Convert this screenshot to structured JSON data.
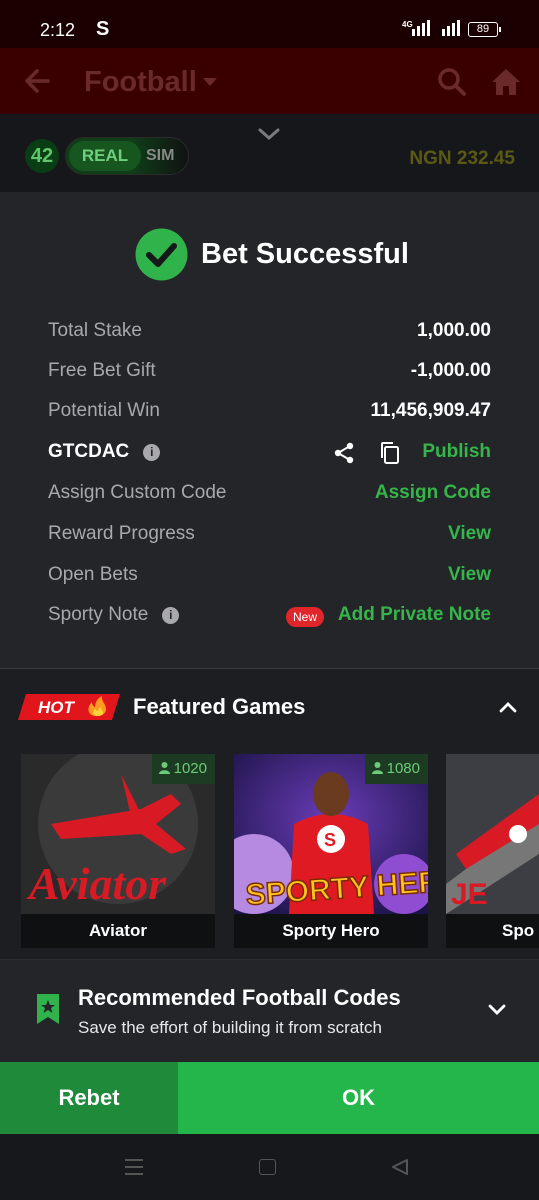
{
  "status_bar": {
    "time": "2:12",
    "app_icon": "S",
    "network": "4G",
    "battery": "89"
  },
  "app_bar": {
    "title": "Football"
  },
  "sub_bar": {
    "count": "42",
    "toggle_on": "REAL",
    "toggle_off": "SIM",
    "balance": "NGN 232.45"
  },
  "result": {
    "title": "Bet Successful",
    "rows": [
      {
        "label": "Total Stake",
        "value": "1,000.00"
      },
      {
        "label": "Free Bet Gift",
        "value": "-1,000.00"
      },
      {
        "label": "Potential Win",
        "value": "11,456,909.47"
      }
    ],
    "code": {
      "label": "GTCDAC",
      "publish": "Publish"
    },
    "assign": {
      "label": "Assign Custom Code",
      "action": "Assign Code"
    },
    "reward": {
      "label": "Reward Progress",
      "action": "View"
    },
    "open_bets": {
      "label": "Open Bets",
      "action": "View"
    },
    "note": {
      "label": "Sporty Note",
      "badge": "New",
      "action": "Add Private Note"
    }
  },
  "featured": {
    "hot_label": "HOT",
    "title": "Featured Games",
    "games": [
      {
        "name": "Aviator",
        "players": "1020"
      },
      {
        "name": "Sporty Hero",
        "players": "1080"
      },
      {
        "name": "Spo",
        "players": ""
      }
    ]
  },
  "recommend": {
    "title": "Recommended Football Codes",
    "subtitle": "Save the effort of building it from scratch"
  },
  "actions": {
    "rebet": "Rebet",
    "ok": "OK"
  },
  "colors": {
    "green": "#35b54a",
    "ok_button": "#25b64b",
    "rebet_button": "#1e8a3a",
    "header": "#3a0000",
    "panel": "#232529"
  }
}
